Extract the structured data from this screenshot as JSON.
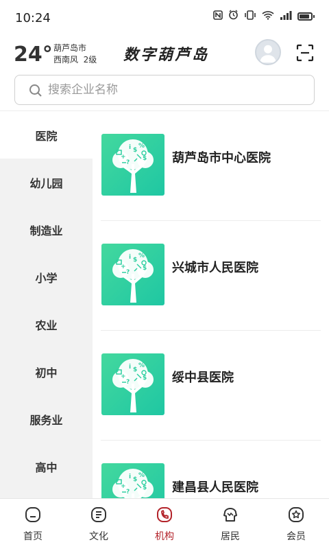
{
  "status_bar": {
    "time": "10:24",
    "icons": [
      "nfc-icon",
      "alarm-icon",
      "vibrate-icon",
      "wifi-icon",
      "signal-icon",
      "battery-icon"
    ],
    "battery_level": 0.85
  },
  "header": {
    "temperature": "24°",
    "city": "葫芦岛市",
    "wind": "西南风  2级",
    "app_title": "数字葫芦岛",
    "icons": [
      "avatar",
      "scan-icon"
    ]
  },
  "search": {
    "placeholder": "搜索企业名称",
    "value": ""
  },
  "categories": [
    {
      "label": "医院",
      "active": true
    },
    {
      "label": "幼儿园",
      "active": false
    },
    {
      "label": "制造业",
      "active": false
    },
    {
      "label": "小学",
      "active": false
    },
    {
      "label": "农业",
      "active": false
    },
    {
      "label": "初中",
      "active": false
    },
    {
      "label": "服务业",
      "active": false
    },
    {
      "label": "高中",
      "active": false
    }
  ],
  "organizations": [
    {
      "name": "葫芦岛市中心医院"
    },
    {
      "name": "兴城市人民医院"
    },
    {
      "name": "绥中县医院"
    },
    {
      "name": "建昌县人民医院"
    }
  ],
  "bottom_nav": [
    {
      "label": "首页",
      "icon": "home-icon",
      "active": false
    },
    {
      "label": "文化",
      "icon": "culture-icon",
      "active": false
    },
    {
      "label": "机构",
      "icon": "institution-icon",
      "active": true
    },
    {
      "label": "居民",
      "icon": "resident-icon",
      "active": false
    },
    {
      "label": "会员",
      "icon": "member-icon",
      "active": false
    }
  ],
  "colors": {
    "accent": "#b3232a",
    "logo_green": "#2fcfa0",
    "sidebar_bg": "#f2f2f2"
  }
}
